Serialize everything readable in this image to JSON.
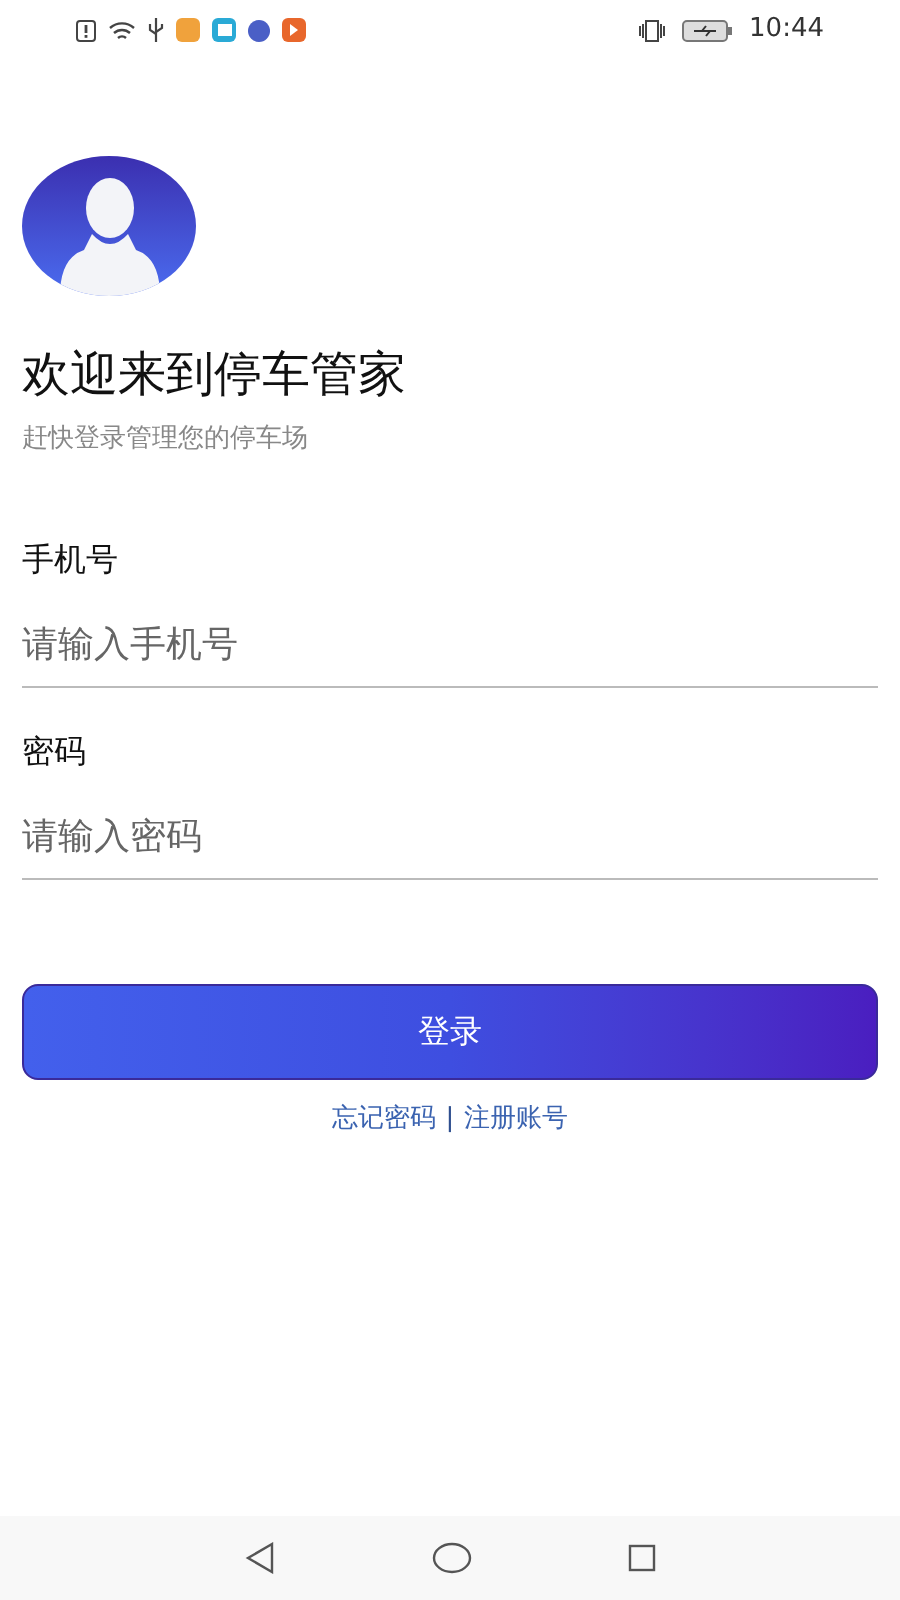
{
  "status_bar": {
    "time": "10:44"
  },
  "header": {
    "title": "欢迎来到停车管家",
    "subtitle": "赶快登录管理您的停车场"
  },
  "fields": [
    {
      "label": "手机号",
      "placeholder": "请输入手机号"
    },
    {
      "label": "密码",
      "placeholder": "请输入密码"
    }
  ],
  "login_button": "登录",
  "links": [
    {
      "kind": "link",
      "text": "忘记密码"
    },
    {
      "kind": "separator",
      "text": "|"
    },
    {
      "kind": "link",
      "text": "注册账号"
    }
  ]
}
